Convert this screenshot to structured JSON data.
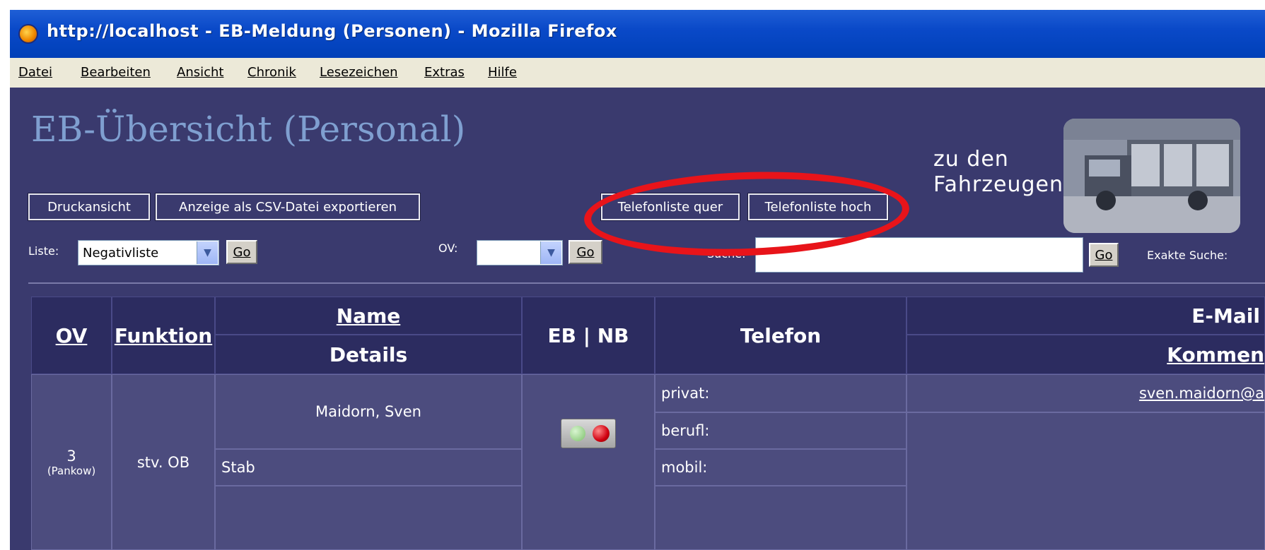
{
  "window": {
    "title": "http://localhost - EB-Meldung (Personen) - Mozilla Firefox"
  },
  "menu": [
    "Datei",
    "Bearbeiten",
    "Ansicht",
    "Chronik",
    "Lesezeichen",
    "Extras",
    "Hilfe"
  ],
  "page": {
    "title": "EB-Übersicht (Personal)",
    "vehicles_link_line1": "zu den",
    "vehicles_link_line2": "Fahrzeugen"
  },
  "toolbar": {
    "print_view": "Druckansicht",
    "csv_export": "Anzeige als CSV-Datei exportieren",
    "phone_landscape": "Telefonliste quer",
    "phone_portrait": "Telefonliste hoch"
  },
  "filters": {
    "list_label": "Liste:",
    "list_value": "Negativliste",
    "ov_label": "OV:",
    "ov_value": "",
    "search_label": "Suche:",
    "search_value": "",
    "exact_label": "Exakte Suche:",
    "go": "Go"
  },
  "table": {
    "headers": {
      "ov": "OV",
      "funktion": "Funktion",
      "name": "Name",
      "details": "Details",
      "ebnb": "EB | NB",
      "telefon": "Telefon",
      "email": "E-Mail",
      "kommentar": "Kommen"
    },
    "row": {
      "ov_number": "3",
      "ov_name": "(Pankow)",
      "funktion": "stv. OB",
      "name": "Maidorn, Sven",
      "details": "Stab",
      "phone_labels": [
        "privat:",
        "berufl:",
        "mobil:"
      ],
      "email": "sven.maidorn@a"
    }
  },
  "colors": {
    "accent_red": "#e8141a",
    "title_blue": "#7f9fd0",
    "bg": "#3a3a6e"
  }
}
